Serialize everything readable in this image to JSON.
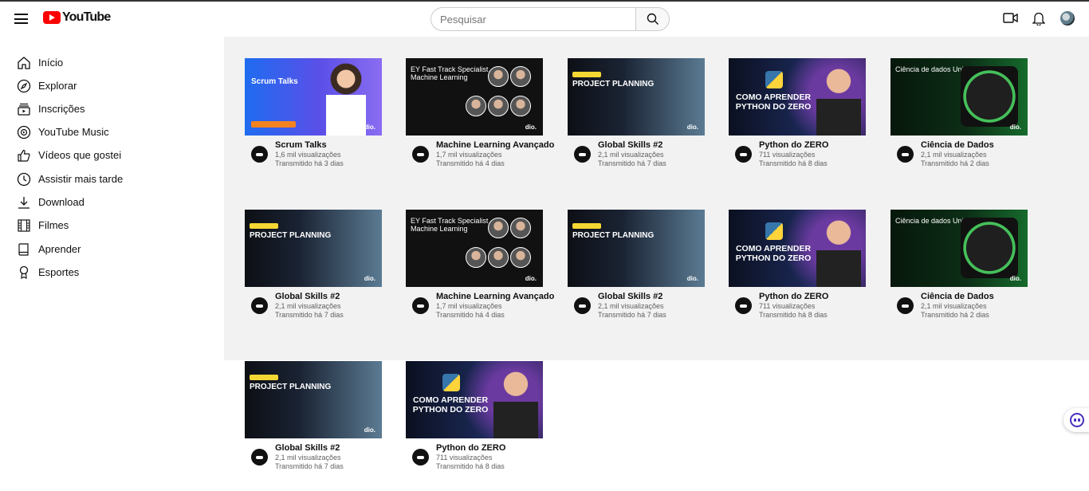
{
  "header": {
    "logo_text": "YouTube",
    "search_placeholder": "Pesquisar"
  },
  "sidebar": {
    "items": [
      {
        "label": "Início",
        "icon": "home-icon"
      },
      {
        "label": "Explorar",
        "icon": "compass-icon"
      },
      {
        "label": "Inscrições",
        "icon": "subscriptions-icon"
      },
      {
        "label": "YouTube Music",
        "icon": "music-icon"
      },
      {
        "label": "Vídeos que gostei",
        "icon": "thumbs-up-icon"
      },
      {
        "label": "Assistir mais tarde",
        "icon": "clock-icon"
      },
      {
        "label": "Download",
        "icon": "download-icon"
      },
      {
        "label": "Filmes",
        "icon": "film-icon"
      },
      {
        "label": "Aprender",
        "icon": "book-icon"
      },
      {
        "label": "Esportes",
        "icon": "trophy-icon"
      }
    ]
  },
  "videos": [
    {
      "title": "Scrum Talks",
      "views": "1,6 mil visualizações",
      "age": "Transmitido há 3 dias",
      "thumb_text": "Scrum Talks"
    },
    {
      "title": "Machine Learning Avançado",
      "views": "1,7 mil visualizações",
      "age": "Transmitido há 4 dias",
      "thumb_text": "EY Fast Track Specialist Machine Learning"
    },
    {
      "title": "Global Skills #2",
      "views": "2,1 mil visualizações",
      "age": "Transmitido há 7 dias",
      "thumb_text": "PROJECT PLANNING"
    },
    {
      "title": "Python do ZERO",
      "views": "711 visualizações",
      "age": "Transmitido há 8 dias",
      "thumb_text": "COMO APRENDER PYTHON DO ZERO"
    },
    {
      "title": "Ciência de Dados",
      "views": "2,1 mil visualizações",
      "age": "Transmitido há 2 dias",
      "thumb_text": "Ciência de dados Unimed - BH"
    },
    {
      "title": "Global Skills #2",
      "views": "2,1 mil visualizações",
      "age": "Transmitido há 7 dias",
      "thumb_text": "PROJECT PLANNING"
    },
    {
      "title": "Machine Learning Avançado",
      "views": "1,7 mil visualizações",
      "age": "Transmitido há 4 dias",
      "thumb_text": "EY Fast Track Specialist Machine Learning"
    },
    {
      "title": "Global Skills #2",
      "views": "2,1 mil visualizações",
      "age": "Transmitido há 7 dias",
      "thumb_text": "PROJECT PLANNING"
    },
    {
      "title": "Python do ZERO",
      "views": "711 visualizações",
      "age": "Transmitido há 8 dias",
      "thumb_text": "COMO APRENDER PYTHON DO ZERO"
    },
    {
      "title": "Ciência de Dados",
      "views": "2,1 mil visualizações",
      "age": "Transmitido há 2 dias",
      "thumb_text": "Ciência de dados Unimed - BH"
    },
    {
      "title": "Global Skills #2",
      "views": "2,1 mil visualizações",
      "age": "Transmitido há 7 dias",
      "thumb_text": "PROJECT PLANNING"
    },
    {
      "title": "Python do ZERO",
      "views": "711 visualizações",
      "age": "Transmitido há 8 dias",
      "thumb_text": "COMO APRENDER PYTHON DO ZERO"
    }
  ],
  "colors": {
    "brand": "#ff0000",
    "band": "#f2f2f2",
    "secondary_text": "#606060"
  }
}
